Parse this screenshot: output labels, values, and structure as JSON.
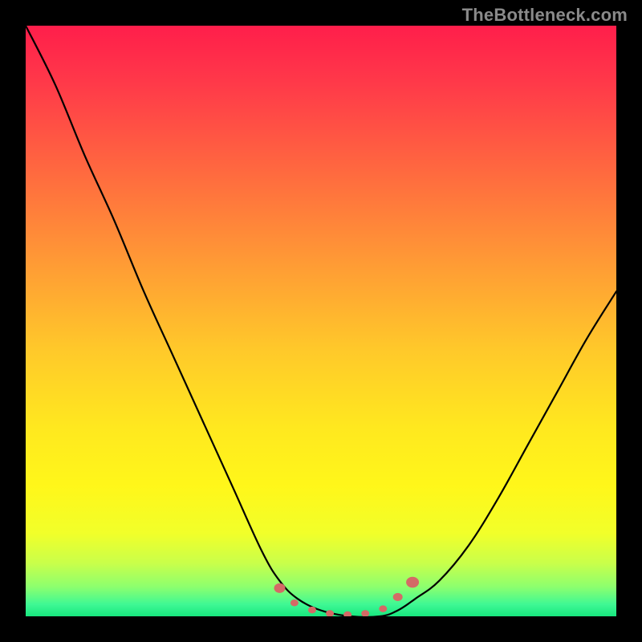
{
  "watermark": "TheBottleneck.com",
  "gradient_stops": [
    {
      "offset": 0.0,
      "color": "#ff1e4b"
    },
    {
      "offset": 0.1,
      "color": "#ff3a49"
    },
    {
      "offset": 0.25,
      "color": "#ff6a3f"
    },
    {
      "offset": 0.4,
      "color": "#ff9a35"
    },
    {
      "offset": 0.55,
      "color": "#ffc92a"
    },
    {
      "offset": 0.68,
      "color": "#ffe81f"
    },
    {
      "offset": 0.78,
      "color": "#fff71a"
    },
    {
      "offset": 0.86,
      "color": "#f1ff2a"
    },
    {
      "offset": 0.91,
      "color": "#c9ff4a"
    },
    {
      "offset": 0.95,
      "color": "#8dff6e"
    },
    {
      "offset": 0.98,
      "color": "#3ef894"
    },
    {
      "offset": 1.0,
      "color": "#17e77e"
    }
  ],
  "marker_color": "#d46a66",
  "curve_color": "#000000",
  "chart_data": {
    "type": "line",
    "title": "",
    "xlabel": "",
    "ylabel": "",
    "x": [
      0.0,
      0.05,
      0.1,
      0.15,
      0.2,
      0.25,
      0.3,
      0.35,
      0.4,
      0.43,
      0.46,
      0.5,
      0.55,
      0.6,
      0.63,
      0.66,
      0.7,
      0.75,
      0.8,
      0.85,
      0.9,
      0.95,
      1.0
    ],
    "y": [
      1.0,
      0.9,
      0.78,
      0.67,
      0.55,
      0.44,
      0.33,
      0.22,
      0.11,
      0.06,
      0.03,
      0.01,
      0.0,
      0.0,
      0.01,
      0.03,
      0.06,
      0.12,
      0.2,
      0.29,
      0.38,
      0.47,
      0.55
    ],
    "annotations": "dotted salmon marker band along trough between x≈0.43 and x≈0.66",
    "ylim": [
      0,
      1
    ],
    "xlim": [
      0,
      1
    ]
  }
}
